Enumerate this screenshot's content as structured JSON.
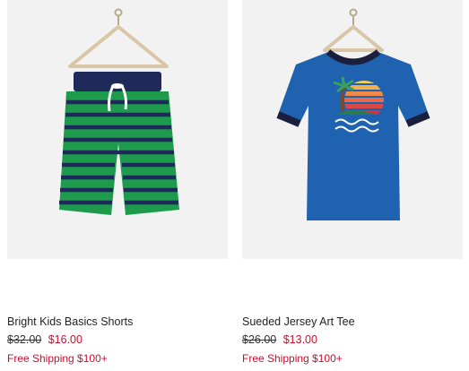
{
  "products": [
    {
      "name": "Bright Kids Basics Shorts",
      "original_price": "$32.00",
      "sale_price": "$16.00",
      "shipping": "Free Shipping $100+",
      "image_icon": "striped-shorts-illustration",
      "colors": {
        "primary": "#1d9a4c",
        "stripe": "#1f2a5a"
      }
    },
    {
      "name": "Sueded Jersey Art Tee",
      "original_price": "$26.00",
      "sale_price": "$13.00",
      "shipping": "Free Shipping $100+",
      "image_icon": "palm-tree-tshirt-illustration",
      "colors": {
        "primary": "#1f63b0",
        "trim": "#1a1f3d"
      }
    }
  ],
  "accent_color": "#c8102e"
}
